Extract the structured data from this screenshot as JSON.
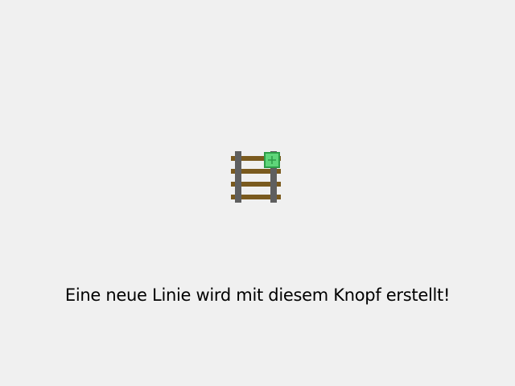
{
  "colors": {
    "background": "#f0f0f0",
    "rail": "#5f5f5f",
    "sleeper": "#7a5a1e",
    "plus_fill": "#5fd67a",
    "plus_border": "#2e9c48",
    "text": "#000000"
  },
  "new_line_button": {
    "icon": "new-rail-line-icon",
    "badge_icon": "plus-icon"
  },
  "hint": {
    "text": "Eine neue Linie wird mit diesem Knopf erstellt!"
  }
}
